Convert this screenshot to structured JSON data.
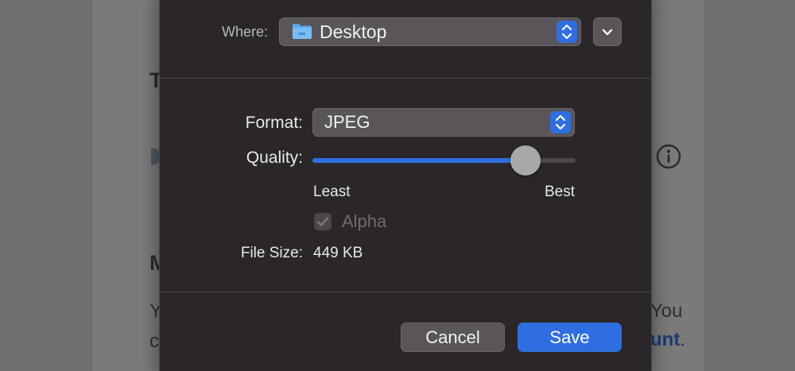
{
  "background": {
    "fragments": {
      "heading_t": "T",
      "heading_m": "M",
      "text_y": "Y",
      "text_c": "c",
      "text_you": "You",
      "link_unt": "unt",
      "period": "."
    }
  },
  "dialog": {
    "where": {
      "label": "Where:",
      "value": "Desktop",
      "icon": "folder-icon"
    },
    "format": {
      "label": "Format:",
      "value": "JPEG"
    },
    "quality": {
      "label": "Quality:",
      "min_label": "Least",
      "max_label": "Best",
      "level_fraction": 0.81
    },
    "alpha": {
      "label": "Alpha",
      "checked": true,
      "enabled": false
    },
    "file_size": {
      "label": "File Size:",
      "value": "449 KB"
    },
    "buttons": {
      "cancel": "Cancel",
      "save": "Save"
    }
  },
  "colors": {
    "accent": "#2f6ee0",
    "sheet_background": "#2a2629",
    "control_background": "#595559"
  }
}
